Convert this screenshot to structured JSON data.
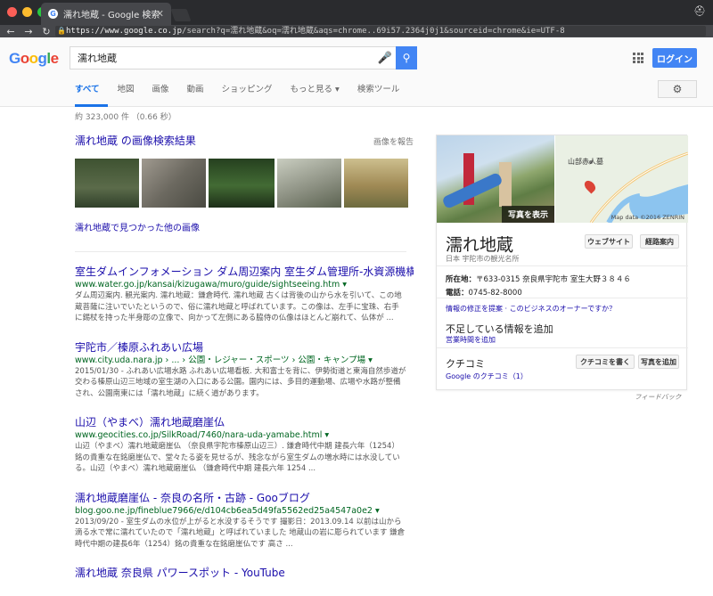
{
  "browser": {
    "tab_title": "濡れ地蔵 - Google 検索",
    "url_host": "https://www.google.co.jp",
    "url_path": "/search?q=濡れ地蔵&oq=濡れ地蔵&aqs=chrome..69i57.2364j0j1&sourceid=chrome&ie=UTF-8"
  },
  "header": {
    "logo_text": "Google",
    "query": "濡れ地蔵",
    "login_label": "ログイン"
  },
  "tabs": [
    {
      "label": "すべて",
      "active": true
    },
    {
      "label": "地図"
    },
    {
      "label": "画像"
    },
    {
      "label": "動画"
    },
    {
      "label": "ショッピング"
    },
    {
      "label": "もっと見る ▾"
    },
    {
      "label": "検索ツール"
    }
  ],
  "stats": "約 323,000 件 （0.66 秒）",
  "images": {
    "title": "濡れ地蔵 の画像検索結果",
    "report": "画像を報告",
    "more": "濡れ地蔵で見つかった他の画像",
    "thumbs": [
      {
        "color": "#4a5a3a"
      },
      {
        "color": "#7d7a72"
      },
      {
        "color": "#2f4a2a"
      },
      {
        "color": "#8a9080"
      },
      {
        "color": "#9b8a5c"
      }
    ]
  },
  "results": [
    {
      "title": "室生ダムインフォメーション ダム周辺案内 室生ダム管理所-水資源機構 ...",
      "url": "www.water.go.jp/kansai/kizugawa/muro/guide/sightseeing.htm ▾",
      "snippet": "ダム周辺案内. 観光案内. 濡れ地蔵：鎌倉時代. 濡れ地蔵 古くは背後の山から水を引いて、この地蔵菩薩に注いでいたというので、俗に濡れ地蔵と呼ばれています。この像は、左手に宝珠、右手に錫杖を持った半身彫の立像で、向かって左側にある脇侍の仏像はほとんど崩れて、仏体が ..."
    },
    {
      "title": "宇陀市／榛原ふれあい広場",
      "url": "www.city.uda.nara.jp › ... › 公園・レジャー・スポーツ › 公園・キャンプ場 ▾",
      "snippet": "2015/01/30 - ふれあい広場水路 ふれあい広場看板. 大和富士を背に、伊勢街道と東海自然歩道が交わる榛原山辺三地域の室生湖の入口にある公園。園内には、多目的運動場、広場や水路が整備され、公園南東には「濡れ地蔵」に続く道があります。"
    },
    {
      "title": "山辺（やまべ）濡れ地蔵磨崖仏",
      "url": "www.geocities.co.jp/SilkRoad/7460/nara-uda-yamabe.html ▾",
      "snippet": "山辺（やまべ）濡れ地蔵磨崖仏 （奈良県宇陀市榛原山辺三）. 鎌倉時代中期 建長六年（1254）銘の貴重な在銘磨崖仏で、堂々たる姿を見せるが、残念ながら室生ダムの増水時には水没している。山辺（やまべ）濡れ地蔵磨崖仏 （鎌倉時代中期 建長六年 1254 ..."
    },
    {
      "title": "濡れ地蔵磨崖仏 - 奈良の名所・古跡 - Gooブログ",
      "url": "blog.goo.ne.jp/fineblue7966/e/d104cb6ea5d49fa5562ed25a4547a0e2 ▾",
      "snippet": "2013/09/20 - 室生ダムの水位が上がると水没するそうです 撮影日：2013.09.14 以前は山から滴る水で常に濡れていたので「濡れ地蔵」と呼ばれていました 地蔵山の岩に彫られています 鎌倉時代中期の建長6年（1254）銘の貴重な在銘磨崖仏です 高さ ..."
    },
    {
      "title": "濡れ地蔵 奈良県 パワースポット - YouTube",
      "url": "",
      "snippet": ""
    }
  ],
  "knowledge_panel": {
    "photo_label": "写真を表示",
    "map_label": "山部赤人墓",
    "map_credit": "Map data ©2016 ZENRIN",
    "title": "濡れ地蔵",
    "subtitle": "日本 宇陀市の観光名所",
    "website_label": "ウェブサイト",
    "directions_label": "経路案内",
    "address_key": "所在地：",
    "address_val": "〒633-0315 奈良県宇陀市 室生大野３８４６",
    "phone_key": "電話：",
    "phone_val": "0745-82-8000",
    "suggest_link": "情報の修正を提案 · このビジネスのオーナーですか？",
    "missing_title": "不足している情報を追加",
    "missing_link": "営業時間を追加",
    "reviews_title": "クチコミ",
    "write_review": "クチコミを書く",
    "add_photo": "写真を追加",
    "google_reviews": "Google のクチコミ（1）",
    "feedback": "フィードバック"
  }
}
